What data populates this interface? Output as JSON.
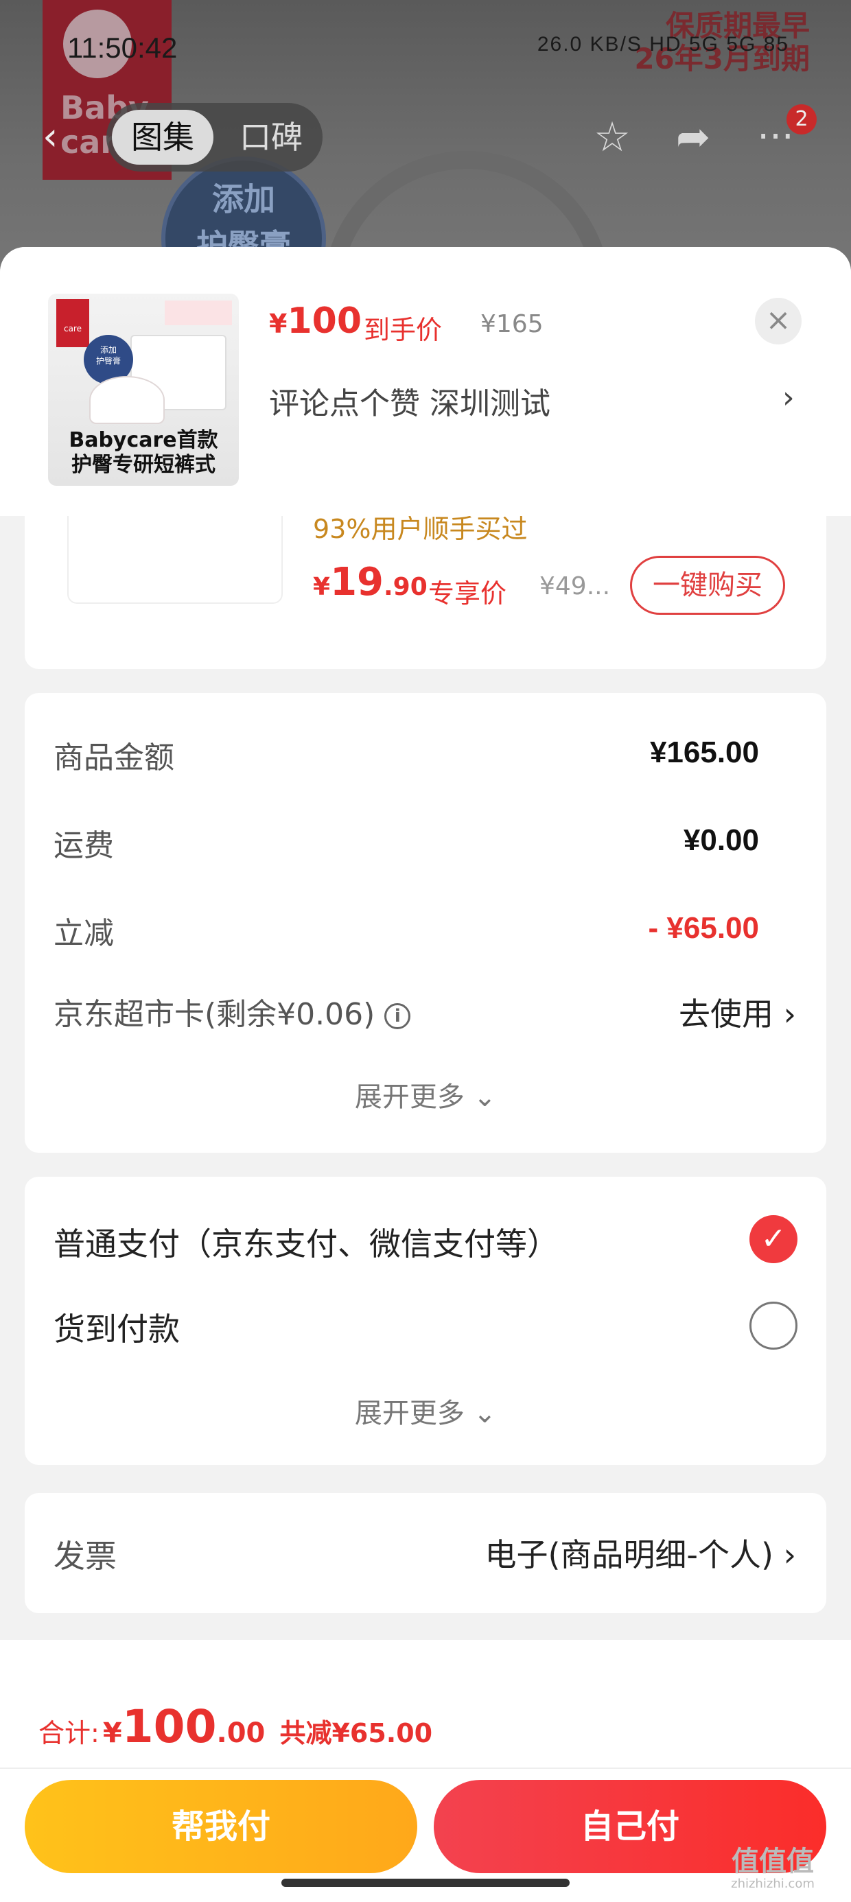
{
  "status_bar": {
    "time": "11:50:42",
    "icons_text": "26.0 KB/S  HD  5G  5G  85"
  },
  "background": {
    "logo_text": "Baby care",
    "promo_text_1": "保质期最早",
    "promo_text_2": "26年3月到期",
    "badge_line_1": "添加",
    "badge_line_2": "护臀膏"
  },
  "top_nav": {
    "tabs": [
      "图集",
      "口碑"
    ],
    "more_badge": "2"
  },
  "sheet": {
    "price_currency": "¥",
    "price": "100",
    "price_label": "到手价",
    "original_price": "¥165",
    "spec_text": "评论点个赞  深圳测试",
    "thumb_caption_1": "Babycare首款",
    "thumb_caption_2": "护臀专研短裤式"
  },
  "upsell": {
    "buyers_text": "93%用户顺手买过",
    "price_currency": "¥",
    "price_int": "19",
    "price_dec": ".90",
    "price_label": "专享价",
    "original_price": "¥49...",
    "buy_button": "一键购买"
  },
  "amounts": {
    "rows": [
      {
        "label": "商品金额",
        "value": "¥165.00"
      },
      {
        "label": "运费",
        "value": "¥0.00"
      },
      {
        "label": "立减",
        "value": "- ¥65.00"
      }
    ],
    "card_label": "京东超市卡(剩余¥0.06)",
    "card_action": "去使用",
    "expand_text": "展开更多"
  },
  "payments": {
    "options": [
      {
        "label": "普通支付（京东支付、微信支付等）",
        "selected": true
      },
      {
        "label": "货到付款",
        "selected": false
      }
    ],
    "expand_text": "展开更多"
  },
  "invoice": {
    "label": "发票",
    "value": "电子(商品明细-个人)"
  },
  "footer": {
    "total_label": "合计:",
    "total_currency": "¥",
    "total_int": "100",
    "total_dec": ".00",
    "saved_text": "共减¥65.00",
    "help_pay_button": "帮我付",
    "self_pay_button": "自己付"
  },
  "watermark": {
    "text": "值值值",
    "sub": "zhizhizhi.com"
  },
  "colors": {
    "accent_red": "#e8312e",
    "yellow_button": "#ffb31a",
    "red_button": "#f63a3c",
    "upsell_gold": "#c8881f"
  }
}
